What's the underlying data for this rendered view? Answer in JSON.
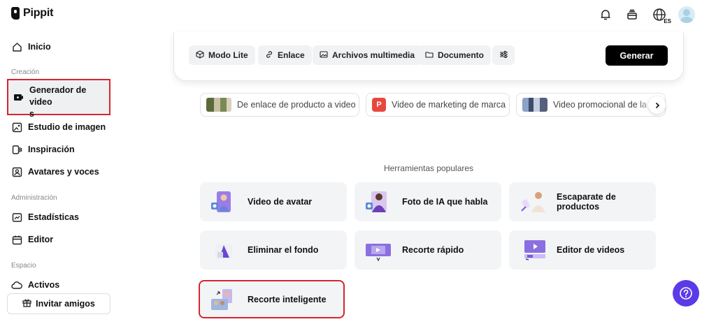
{
  "app": {
    "name": "Pippit"
  },
  "topbar": {
    "icons": [
      "bell-icon",
      "credits-icon",
      "globe-icon",
      "user-avatar"
    ],
    "language_badge": "ES"
  },
  "sidebar": {
    "home": "Inicio",
    "section_creation": "Creación",
    "video_generator": "Generador de video\ns",
    "image_studio": "Estudio de imagen",
    "inspiration": "Inspiración",
    "avatars_voices": "Avatares y voces",
    "section_admin": "Administración",
    "statistics": "Estadísticas",
    "editor": "Editor",
    "section_space": "Espacio",
    "assets": "Activos",
    "invite": "Invitar amigos"
  },
  "prompt": {
    "chips": {
      "lite": "Modo Lite",
      "link": "Enlace",
      "media": "Archivos multimedia",
      "document": "Documento"
    },
    "generate": "Generar"
  },
  "suggestions": {
    "s1": "De enlace de producto a video",
    "s2_badge": "P",
    "s2": "Video de marketing de marca",
    "s3": "Video promocional de la"
  },
  "tools": {
    "title": "Herramientas populares",
    "t1": "Video de avatar",
    "t2": "Foto de IA que habla",
    "t3": "Escaparate de productos",
    "t4": "Eliminar el fondo",
    "t5": "Recorte rápido",
    "t6": "Editor de videos",
    "t7": "Recorte inteligente"
  },
  "colors": {
    "accent_purple": "#5b3be8",
    "highlight_red": "#d4262e",
    "generate_bg": "#000000"
  }
}
